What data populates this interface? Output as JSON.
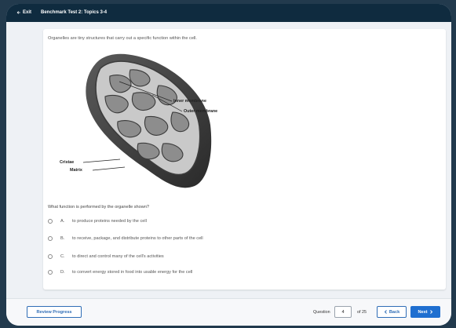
{
  "topbar": {
    "exit_label": "Exit",
    "title": "Benchmark Test 2: Topics 3-4"
  },
  "card": {
    "prompt": "Organelles are tiny structures that carry out a specific function within the cell.",
    "diagram_labels": {
      "inner_membrane": "Inner membrane",
      "outer_membrane": "Outer membrane",
      "cristae": "Cristae",
      "matrix": "Matrix"
    },
    "question": "What function is performed by the organelle shown?",
    "options": [
      {
        "letter": "A.",
        "text": "to produce proteins needed by the cell"
      },
      {
        "letter": "B.",
        "text": "to receive, package, and distribute proteins to other parts of the cell"
      },
      {
        "letter": "C.",
        "text": "to direct and control many of the cell's activities"
      },
      {
        "letter": "D.",
        "text": "to convert energy stored in food into usable energy for the cell"
      }
    ]
  },
  "footer": {
    "review_label": "Review Progress",
    "question_label": "Question",
    "question_value": "4",
    "question_total": "of 25",
    "back_label": "Back",
    "next_label": "Next"
  }
}
